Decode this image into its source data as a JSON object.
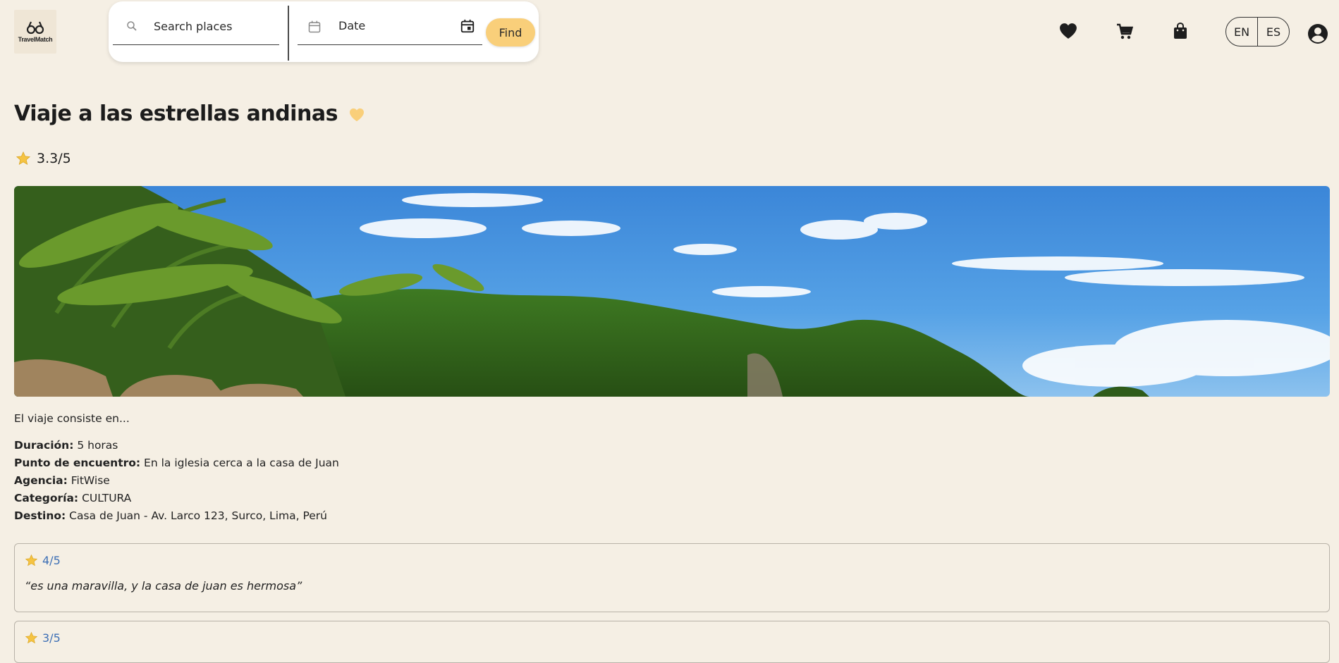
{
  "header": {
    "logo_text": "TravelMatch",
    "search_placeholder": "Search places",
    "date_label": "Date",
    "find_label": "Find",
    "icons": [
      "heart-icon",
      "cart-icon",
      "shopping-bag-icon",
      "account-circle-icon"
    ],
    "languages": [
      "EN",
      "ES"
    ]
  },
  "tour": {
    "title": "Viaje a las estrellas andinas",
    "rating": "3.3/5",
    "description": "El viaje consiste en...",
    "details": [
      {
        "label": "Duración:",
        "value": "5 horas"
      },
      {
        "label": "Punto de encuentro:",
        "value": "En la iglesia cerca a la casa de Juan"
      },
      {
        "label": "Agencia:",
        "value": "FitWise"
      },
      {
        "label": "Categoría:",
        "value": "CULTURA"
      },
      {
        "label": "Destino:",
        "value": "Casa de Juan - Av. Larco 123, Surco, Lima, Perú"
      }
    ]
  },
  "reviews": [
    {
      "rating": "4/5",
      "comment": "“es una maravilla, y la casa de juan es hermosa”"
    },
    {
      "rating": "3/5",
      "comment": ""
    }
  ],
  "colors": {
    "background": "#f5efe4",
    "accent": "#f9cf7a",
    "star": "#f5c342",
    "review_rating": "#3d6fb5"
  }
}
